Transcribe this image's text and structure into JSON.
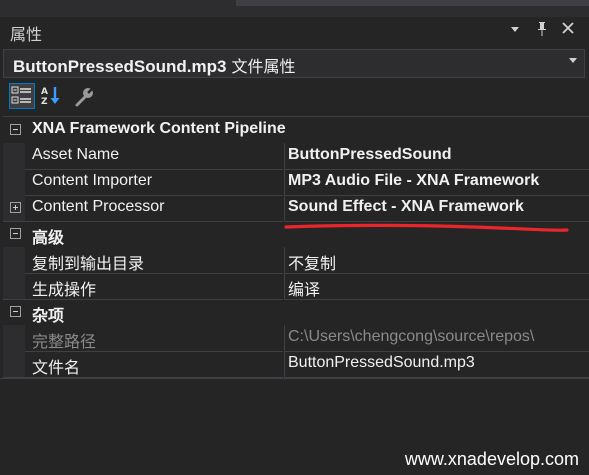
{
  "panel": {
    "title": "属性",
    "dropdown_icon": "chevron-down-icon",
    "pin_icon": "pin-icon",
    "close_icon": "close-icon"
  },
  "object_selector": {
    "name": "ButtonPressedSound.mp3",
    "suffix": " 文件属性"
  },
  "toolbar": {
    "buttons": [
      {
        "icon": "categorized-icon",
        "selected": true
      },
      {
        "icon": "alphabetical-sort-icon",
        "selected": false
      },
      {
        "icon": "property-pages-wrench-icon",
        "selected": false
      }
    ]
  },
  "grid": {
    "categories": [
      {
        "label": "XNA Framework Content Pipeline",
        "expanded": true,
        "properties": [
          {
            "name": "Asset Name",
            "value": "ButtonPressedSound",
            "bold": true
          },
          {
            "name": "Content Importer",
            "value": "MP3 Audio File - XNA Framework",
            "bold": true
          },
          {
            "name": "Content Processor",
            "value": "Sound Effect - XNA Framework",
            "bold": true,
            "expandable": true
          }
        ]
      },
      {
        "label": "高级",
        "expanded": true,
        "properties": [
          {
            "name": "复制到输出目录",
            "value": "不复制",
            "bold": false
          },
          {
            "name": "生成操作",
            "value": "编译",
            "bold": false
          }
        ]
      },
      {
        "label": "杂项",
        "expanded": true,
        "properties": [
          {
            "name": "完整路径",
            "value": "C:\\Users\\chengcong\\source\\repos\\",
            "bold": false,
            "disabled": true
          },
          {
            "name": "文件名",
            "value": "ButtonPressedSound.mp3",
            "bold": false
          }
        ]
      }
    ]
  },
  "annotation": {
    "underline_color": "#e8262c"
  },
  "watermark": "www.xnadevelop.com"
}
